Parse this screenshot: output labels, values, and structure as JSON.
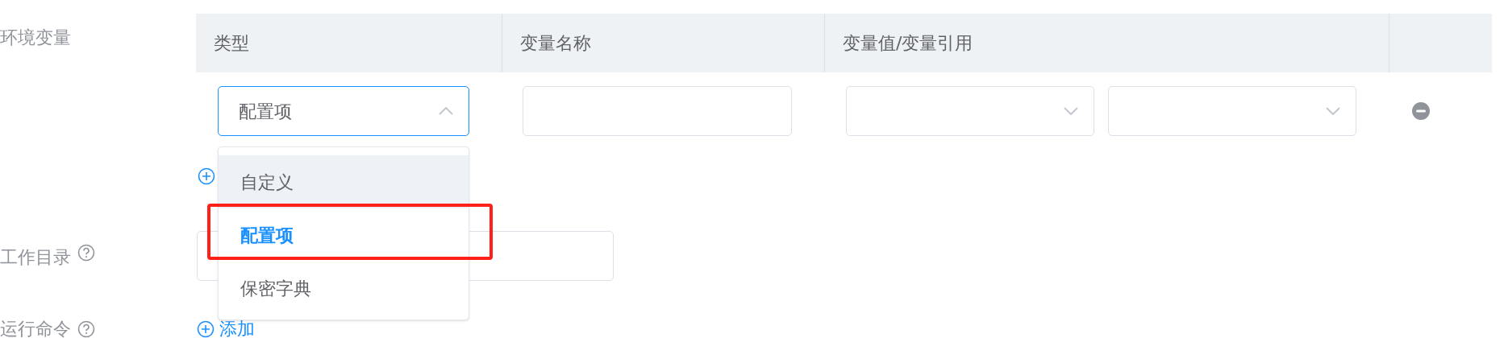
{
  "env_vars": {
    "label": "环境变量",
    "columns": [
      "类型",
      "变量名称",
      "变量值/变量引用"
    ],
    "rows": [
      {
        "type_value": "配置项",
        "expanded": true
      }
    ]
  },
  "type_dropdown": {
    "options": [
      {
        "label": "自定义",
        "hovered": true,
        "selected": false
      },
      {
        "label": "配置项",
        "hovered": false,
        "selected": true
      },
      {
        "label": "保密字典",
        "hovered": false,
        "selected": false
      }
    ]
  },
  "workdir": {
    "label": "工作目录"
  },
  "command": {
    "label": "运行命令",
    "add_label": "添加"
  }
}
